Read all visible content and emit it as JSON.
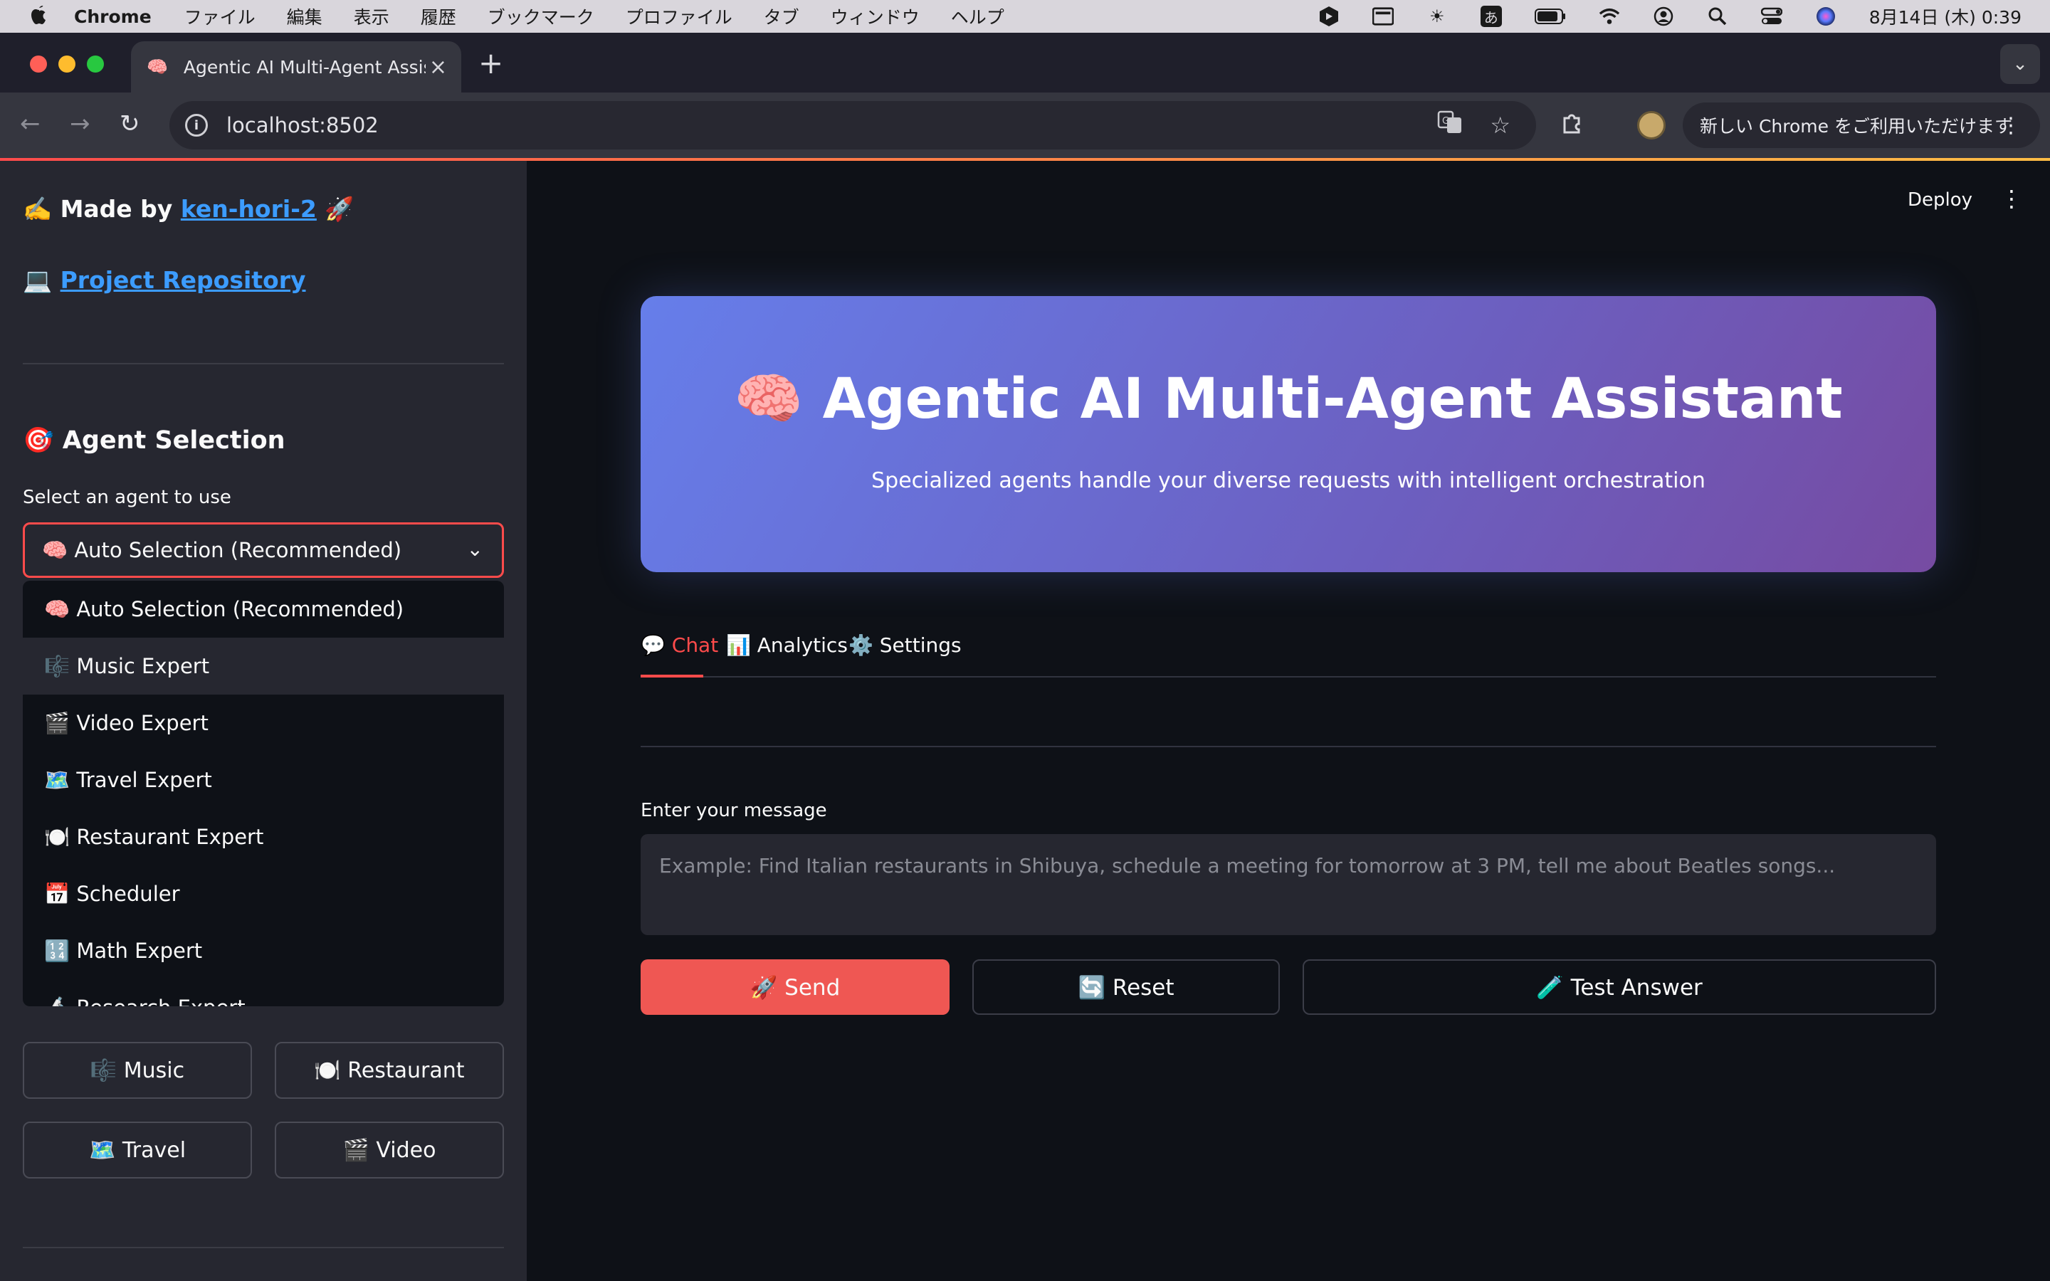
{
  "menubar": {
    "app_name": "Chrome",
    "items": [
      "ファイル",
      "編集",
      "表示",
      "履歴",
      "ブックマーク",
      "プロファイル",
      "タブ",
      "ウィンドウ",
      "ヘルプ"
    ],
    "ime_indicator": "あ",
    "clock": "8月14日 (木)  0:39"
  },
  "browser": {
    "tab_icon": "🧠",
    "tab_title": "Agentic AI Multi-Agent Assist",
    "tab_close": "×",
    "new_tab": "+",
    "url": "localhost:8502",
    "update_chip": "新しい Chrome をご利用いただけます"
  },
  "sidebar": {
    "made_by_prefix": "✍️ Made by ",
    "made_by_link": "ken-hori-2",
    "made_by_suffix": " 🚀",
    "repo_icon": "💻 ",
    "repo_link": "Project Repository",
    "agent_heading": "🎯 Agent Selection",
    "select_label": "Select an agent to use",
    "selected_value": "🧠 Auto Selection (Recommended)",
    "dropdown_options": [
      "🧠 Auto Selection (Recommended)",
      "🎼 Music Expert",
      "🎬 Video Expert",
      "🗺️ Travel Expert",
      "🍽️ Restaurant Expert",
      "📅 Scheduler",
      "🔢 Math Expert",
      "🔬 Research Expert"
    ],
    "hovered_option_index": 1,
    "quick_buttons": [
      "🎼 Music",
      "🍽️ Restaurant",
      "🗺️ Travel",
      "🎬 Video"
    ]
  },
  "main": {
    "deploy_label": "Deploy",
    "menu_label": "⋮",
    "hero_title": "🧠 Agentic AI Multi-Agent Assistant",
    "hero_subtitle": "Specialized agents handle your diverse requests with intelligent orchestration",
    "tabs": [
      "💬 Chat",
      "📊 Analytics",
      "⚙️ Settings"
    ],
    "active_tab": 0,
    "message_label": "Enter your message",
    "message_placeholder": "Example: Find Italian restaurants in Shibuya, schedule a meeting for tomorrow at 3 PM, tell me about Beatles songs...",
    "send_label": "🚀 Send",
    "reset_label": "🔄 Reset",
    "test_label": "🧪 Test Answer"
  },
  "colors": {
    "accent": "#ff4b4b",
    "send_button": "#ef5753",
    "link": "#3c9cff",
    "hero_gradient_start": "#667eea",
    "hero_gradient_end": "#764ba2",
    "background": "#0e1117",
    "sidebar_background": "#262730"
  },
  "icons": {
    "menubar": [
      "apple-icon",
      "ai-app-icon",
      "display-icon",
      "brightness-icon",
      "battery-icon",
      "wifi-icon",
      "user-icon",
      "spotlight-search-icon",
      "control-center-icon",
      "siri-icon"
    ],
    "toolbar": [
      "back-arrow-icon",
      "forward-arrow-icon",
      "reload-icon",
      "site-info-icon",
      "translate-icon",
      "bookmark-star-icon",
      "extensions-puzzle-icon",
      "profile-avatar-icon",
      "chrome-menu-icon"
    ]
  }
}
